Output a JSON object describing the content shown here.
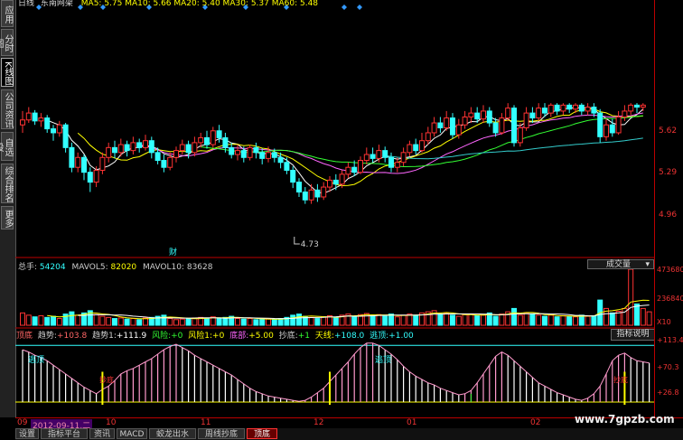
{
  "side_tabs": [
    {
      "label": "应用",
      "active": false
    },
    {
      "label": "分时图",
      "active": false
    },
    {
      "label": "K线图",
      "active": true
    },
    {
      "label": "公司资讯",
      "active": false
    },
    {
      "label": "自选股",
      "active": false
    },
    {
      "label": "综合排名",
      "active": false
    },
    {
      "label": "更多",
      "active": false
    }
  ],
  "price_chart": {
    "title": "日线",
    "stock": "东南网架",
    "ma_legend": "MA5: 5.75  MA10: 5.66  MA20: 5.40  MA30: 5.37  MA60: 5.48",
    "low_marker": "4.73",
    "event_marker": "财",
    "price_ticks": [
      "5.62",
      "5.29",
      "4.96"
    ]
  },
  "volume": {
    "legend_label": "总手:",
    "legend_value": "54204",
    "mavol5_label": "MAVOL5:",
    "mavol5_value": "82020",
    "mavol10_label": "MAVOL10:",
    "mavol10_value": "83628",
    "dropdown": "成交量",
    "ticks": [
      "473680",
      "236840",
      "X10"
    ]
  },
  "indicator": {
    "name": "顶底",
    "items": [
      {
        "label": "趋势:",
        "value": "+103.8"
      },
      {
        "label": "趋势1:",
        "value": "+111.9"
      },
      {
        "label": "风险:",
        "value": "+0"
      },
      {
        "label": "风险1:",
        "value": "+0"
      },
      {
        "label": "底部:",
        "value": "+5.00"
      },
      {
        "label": "抄底:",
        "value": "+1"
      },
      {
        "label": "天线:",
        "value": "+108.0"
      },
      {
        "label": "逃顶:",
        "value": "+1.00"
      }
    ],
    "help": "指标说明",
    "ticks": [
      "+113.4",
      "+70.3",
      "+26.8"
    ],
    "annotations": [
      "逃顶",
      "逃顶",
      "抄底",
      "抄底"
    ]
  },
  "date_axis": {
    "cursor": "2012-09-11,二",
    "labels": [
      "09",
      "10",
      "11",
      "12",
      "01",
      "02"
    ]
  },
  "bottom_tabs": [
    {
      "label": "设置",
      "active": false
    },
    {
      "label": "指标平台",
      "active": false
    },
    {
      "label": "资讯",
      "active": false
    },
    {
      "label": "MACD",
      "active": false
    },
    {
      "label": "蛟龙出水",
      "active": false
    },
    {
      "label": "周线抄底",
      "active": false
    },
    {
      "label": "顶底",
      "active": true
    }
  ],
  "watermark": "www.7gpzb.com",
  "colors": {
    "up": "#ff3333",
    "down": "#33ffff",
    "ma5": "#ffffff",
    "ma10": "#ffff00",
    "ma20": "#ff66ff",
    "ma30": "#33ff33",
    "ma60": "#33cccc",
    "axis": "#bb0000"
  },
  "candles": [
    [
      5.78,
      5.83,
      5.92,
      5.7
    ],
    [
      5.83,
      5.9,
      5.96,
      5.8
    ],
    [
      5.9,
      5.82,
      5.93,
      5.78
    ],
    [
      5.82,
      5.85,
      5.9,
      5.76
    ],
    [
      5.85,
      5.74,
      5.88,
      5.7
    ],
    [
      5.74,
      5.7,
      5.78,
      5.62
    ],
    [
      5.7,
      5.78,
      5.82,
      5.66
    ],
    [
      5.78,
      5.55,
      5.8,
      5.5
    ],
    [
      5.55,
      5.35,
      5.6,
      5.3
    ],
    [
      5.35,
      5.45,
      5.5,
      5.3
    ],
    [
      5.45,
      5.3,
      5.48,
      5.22
    ],
    [
      5.3,
      5.2,
      5.35,
      5.1
    ],
    [
      5.2,
      5.32,
      5.36,
      5.15
    ],
    [
      5.32,
      5.45,
      5.5,
      5.28
    ],
    [
      5.45,
      5.55,
      5.6,
      5.4
    ],
    [
      5.55,
      5.5,
      5.62,
      5.44
    ],
    [
      5.5,
      5.58,
      5.64,
      5.46
    ],
    [
      5.58,
      5.52,
      5.62,
      5.46
    ],
    [
      5.52,
      5.6,
      5.66,
      5.48
    ],
    [
      5.6,
      5.55,
      5.64,
      5.5
    ],
    [
      5.55,
      5.62,
      5.68,
      5.52
    ],
    [
      5.62,
      5.5,
      5.66,
      5.44
    ],
    [
      5.5,
      5.42,
      5.55,
      5.38
    ],
    [
      5.42,
      5.35,
      5.48,
      5.3
    ],
    [
      5.35,
      5.45,
      5.5,
      5.32
    ],
    [
      5.45,
      5.52,
      5.56,
      5.4
    ],
    [
      5.52,
      5.58,
      5.63,
      5.48
    ],
    [
      5.58,
      5.5,
      5.62,
      5.44
    ],
    [
      5.5,
      5.6,
      5.66,
      5.46
    ],
    [
      5.6,
      5.65,
      5.7,
      5.55
    ],
    [
      5.65,
      5.58,
      5.72,
      5.54
    ],
    [
      5.58,
      5.72,
      5.76,
      5.55
    ],
    [
      5.72,
      5.65,
      5.78,
      5.6
    ],
    [
      5.65,
      5.55,
      5.7,
      5.5
    ],
    [
      5.55,
      5.48,
      5.6,
      5.44
    ],
    [
      5.48,
      5.52,
      5.58,
      5.42
    ],
    [
      5.52,
      5.45,
      5.56,
      5.4
    ],
    [
      5.45,
      5.55,
      5.58,
      5.42
    ],
    [
      5.55,
      5.5,
      5.6,
      5.44
    ],
    [
      5.5,
      5.44,
      5.54,
      5.38
    ],
    [
      5.44,
      5.5,
      5.56,
      5.4
    ],
    [
      5.5,
      5.45,
      5.54,
      5.4
    ],
    [
      5.45,
      5.4,
      5.5,
      5.34
    ],
    [
      5.4,
      5.32,
      5.45,
      5.28
    ],
    [
      5.32,
      5.2,
      5.36,
      5.14
    ],
    [
      5.2,
      5.1,
      5.24,
      5.05
    ],
    [
      5.1,
      5.02,
      5.15,
      4.98
    ],
    [
      5.02,
      5.12,
      5.18,
      4.98
    ],
    [
      5.12,
      5.05,
      5.18,
      5.0
    ],
    [
      5.05,
      5.15,
      5.2,
      5.02
    ],
    [
      5.15,
      5.22,
      5.26,
      5.1
    ],
    [
      5.22,
      5.18,
      5.28,
      5.12
    ],
    [
      5.18,
      5.28,
      5.32,
      5.14
    ],
    [
      5.28,
      5.35,
      5.4,
      5.24
    ],
    [
      5.35,
      5.3,
      5.42,
      5.26
    ],
    [
      5.3,
      5.42,
      5.46,
      5.28
    ],
    [
      5.42,
      5.48,
      5.55,
      5.38
    ],
    [
      5.48,
      5.44,
      5.55,
      5.4
    ],
    [
      5.44,
      5.52,
      5.58,
      5.4
    ],
    [
      5.52,
      5.45,
      5.56,
      5.4
    ],
    [
      5.45,
      5.35,
      5.5,
      5.3
    ],
    [
      5.35,
      5.4,
      5.45,
      5.3
    ],
    [
      5.4,
      5.5,
      5.55,
      5.36
    ],
    [
      5.5,
      5.58,
      5.62,
      5.46
    ],
    [
      5.58,
      5.52,
      5.64,
      5.48
    ],
    [
      5.52,
      5.62,
      5.7,
      5.5
    ],
    [
      5.62,
      5.7,
      5.76,
      5.58
    ],
    [
      5.7,
      5.8,
      5.86,
      5.66
    ],
    [
      5.8,
      5.75,
      5.86,
      5.7
    ],
    [
      5.75,
      5.85,
      5.92,
      5.72
    ],
    [
      5.85,
      5.68,
      5.9,
      5.64
    ],
    [
      5.68,
      5.78,
      5.84,
      5.64
    ],
    [
      5.78,
      5.86,
      5.92,
      5.74
    ],
    [
      5.86,
      5.9,
      5.96,
      5.8
    ],
    [
      5.9,
      5.84,
      5.96,
      5.8
    ],
    [
      5.84,
      5.92,
      5.98,
      5.8
    ],
    [
      5.92,
      5.8,
      5.96,
      5.76
    ],
    [
      5.8,
      5.7,
      5.85,
      5.66
    ],
    [
      5.7,
      5.85,
      5.9,
      5.68
    ],
    [
      5.85,
      5.95,
      6.0,
      5.82
    ],
    [
      5.95,
      5.6,
      5.98,
      5.56
    ],
    [
      5.6,
      5.75,
      5.8,
      5.56
    ],
    [
      5.75,
      5.9,
      5.96,
      5.72
    ],
    [
      5.9,
      5.85,
      5.96,
      5.8
    ],
    [
      5.85,
      5.95,
      6.0,
      5.82
    ],
    [
      5.95,
      5.9,
      6.0,
      5.86
    ],
    [
      5.9,
      5.98,
      6.0,
      5.86
    ],
    [
      5.98,
      5.92,
      6.0,
      5.88
    ],
    [
      5.92,
      5.98,
      6.0,
      5.88
    ],
    [
      5.98,
      5.94,
      6.0,
      5.9
    ],
    [
      5.94,
      5.98,
      6.0,
      5.9
    ],
    [
      5.98,
      5.92,
      6.0,
      5.88
    ],
    [
      5.92,
      5.96,
      6.0,
      5.88
    ],
    [
      5.96,
      5.9,
      6.0,
      5.86
    ],
    [
      5.9,
      5.66,
      5.94,
      5.6
    ],
    [
      5.66,
      5.78,
      5.84,
      5.62
    ],
    [
      5.78,
      5.7,
      5.84,
      5.66
    ],
    [
      5.7,
      5.86,
      5.92,
      5.68
    ],
    [
      5.86,
      5.92,
      5.98,
      5.82
    ],
    [
      5.92,
      5.98,
      6.0,
      5.88
    ],
    [
      5.98,
      5.96,
      6.0,
      5.9
    ],
    [
      5.96,
      5.98,
      6.0,
      5.92
    ]
  ],
  "volumes": [
    0.22,
    0.18,
    0.15,
    0.17,
    0.14,
    0.16,
    0.12,
    0.2,
    0.24,
    0.18,
    0.22,
    0.26,
    0.19,
    0.16,
    0.14,
    0.12,
    0.13,
    0.11,
    0.12,
    0.1,
    0.13,
    0.14,
    0.16,
    0.18,
    0.12,
    0.1,
    0.11,
    0.12,
    0.13,
    0.14,
    0.12,
    0.15,
    0.13,
    0.14,
    0.16,
    0.12,
    0.11,
    0.12,
    0.1,
    0.12,
    0.11,
    0.1,
    0.12,
    0.14,
    0.18,
    0.2,
    0.16,
    0.14,
    0.12,
    0.15,
    0.17,
    0.14,
    0.18,
    0.2,
    0.16,
    0.19,
    0.21,
    0.17,
    0.19,
    0.16,
    0.2,
    0.15,
    0.18,
    0.2,
    0.17,
    0.22,
    0.24,
    0.26,
    0.2,
    0.22,
    0.18,
    0.16,
    0.19,
    0.2,
    0.17,
    0.18,
    0.22,
    0.16,
    0.2,
    0.24,
    0.3,
    0.18,
    0.22,
    0.2,
    0.18,
    0.16,
    0.18,
    0.15,
    0.17,
    0.16,
    0.15,
    0.18,
    0.16,
    0.17,
    0.45,
    0.3,
    0.22,
    0.25,
    0.3,
    1.0,
    0.38,
    0.3,
    0.24
  ],
  "osc": [
    100,
    96,
    90,
    86,
    80,
    72,
    64,
    56,
    48,
    40,
    32,
    26,
    20,
    28,
    34,
    44,
    56,
    62,
    66,
    72,
    78,
    84,
    92,
    100,
    106,
    110,
    104,
    98,
    90,
    84,
    78,
    72,
    66,
    60,
    54,
    46,
    38,
    30,
    24,
    20,
    16,
    14,
    12,
    10,
    8,
    6,
    8,
    14,
    22,
    30,
    42,
    54,
    66,
    78,
    92,
    104,
    112,
    112,
    108,
    100,
    92,
    82,
    70,
    60,
    52,
    46,
    40,
    36,
    30,
    26,
    22,
    18,
    20,
    26,
    40,
    56,
    72,
    88,
    96,
    90,
    80,
    70,
    60,
    50,
    40,
    34,
    28,
    22,
    18,
    14,
    10,
    8,
    12,
    20,
    34,
    56,
    80,
    90,
    94,
    86,
    80,
    78,
    76
  ]
}
